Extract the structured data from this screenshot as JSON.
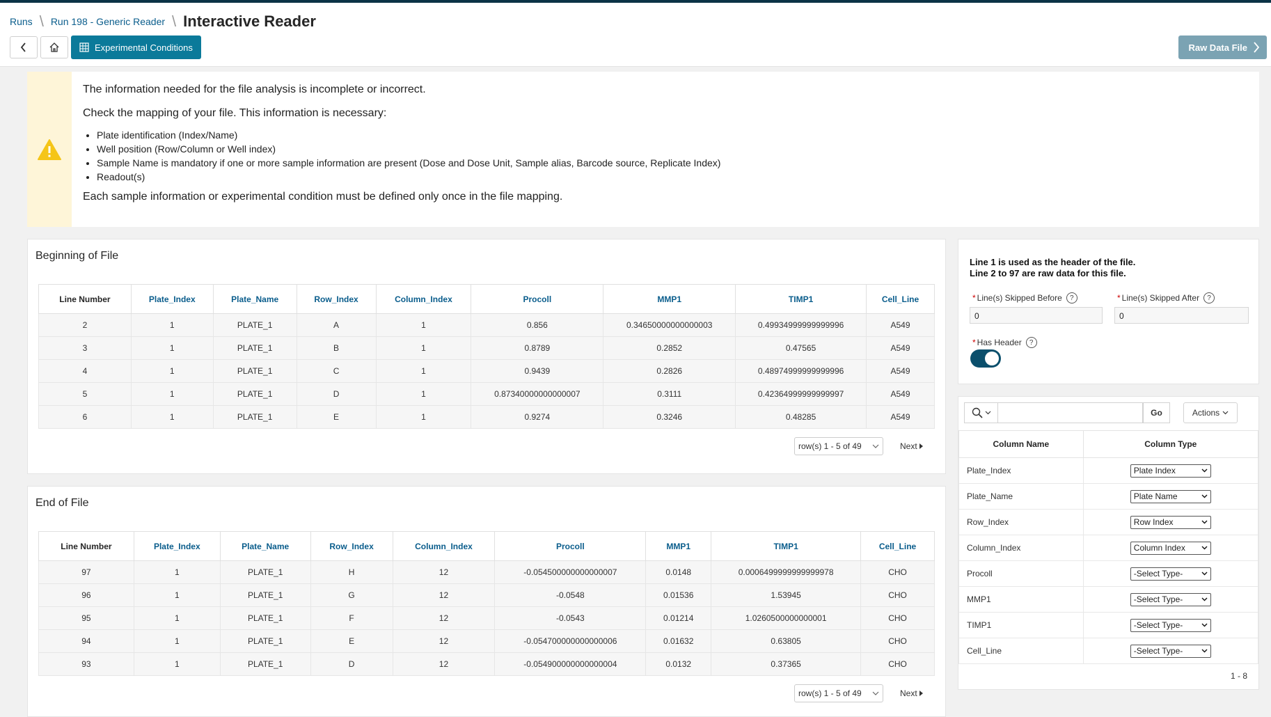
{
  "breadcrumb": {
    "runs": "Runs",
    "run": "Run 198 - Generic Reader",
    "title": "Interactive Reader"
  },
  "toolbar": {
    "experimental_conditions": "Experimental Conditions",
    "raw_data_file": "Raw Data File"
  },
  "alert": {
    "line1": "The information needed for the file analysis is incomplete or incorrect.",
    "line2": "Check the mapping of your file. This information is necessary:",
    "items": [
      "Plate identification (Index/Name)",
      "Well position (Row/Column or Well index)",
      "Sample Name is mandatory if one or more sample information are present (Dose and Dose Unit, Sample alias, Barcode source, Replicate Index)",
      "Readout(s)"
    ],
    "line3": "Each sample information or experimental condition must be defined only once in the file mapping."
  },
  "beginning": {
    "title": "Beginning of File",
    "headers": [
      "Line Number",
      "Plate_Index",
      "Plate_Name",
      "Row_Index",
      "Column_Index",
      "Procoll",
      "MMP1",
      "TIMP1",
      "Cell_Line"
    ],
    "rows": [
      [
        "2",
        "1",
        "PLATE_1",
        "A",
        "1",
        "0.856",
        "0.34650000000000003",
        "0.49934999999999996",
        "A549"
      ],
      [
        "3",
        "1",
        "PLATE_1",
        "B",
        "1",
        "0.8789",
        "0.2852",
        "0.47565",
        "A549"
      ],
      [
        "4",
        "1",
        "PLATE_1",
        "C",
        "1",
        "0.9439",
        "0.2826",
        "0.48974999999999996",
        "A549"
      ],
      [
        "5",
        "1",
        "PLATE_1",
        "D",
        "1",
        "0.87340000000000007",
        "0.3111",
        "0.42364999999999997",
        "A549"
      ],
      [
        "6",
        "1",
        "PLATE_1",
        "E",
        "1",
        "0.9274",
        "0.3246",
        "0.48285",
        "A549"
      ]
    ],
    "pager": "row(s) 1 - 5 of 49",
    "next": "Next"
  },
  "end": {
    "title": "End of File",
    "headers": [
      "Line Number",
      "Plate_Index",
      "Plate_Name",
      "Row_Index",
      "Column_Index",
      "Procoll",
      "MMP1",
      "TIMP1",
      "Cell_Line"
    ],
    "rows": [
      [
        "97",
        "1",
        "PLATE_1",
        "H",
        "12",
        "-0.054500000000000007",
        "0.0148",
        "0.0006499999999999978",
        "CHO"
      ],
      [
        "96",
        "1",
        "PLATE_1",
        "G",
        "12",
        "-0.0548",
        "0.01536",
        "1.53945",
        "CHO"
      ],
      [
        "95",
        "1",
        "PLATE_1",
        "F",
        "12",
        "-0.0543",
        "0.01214",
        "1.0260500000000001",
        "CHO"
      ],
      [
        "94",
        "1",
        "PLATE_1",
        "E",
        "12",
        "-0.054700000000000006",
        "0.01632",
        "0.63805",
        "CHO"
      ],
      [
        "93",
        "1",
        "PLATE_1",
        "D",
        "12",
        "-0.054900000000000004",
        "0.0132",
        "0.37365",
        "CHO"
      ]
    ],
    "pager": "row(s) 1 - 5 of 49",
    "next": "Next"
  },
  "settings": {
    "info1": "Line 1 is used as the header of the file.",
    "info2": "Line 2 to 97 are raw data for this file.",
    "skipped_before_label": "Line(s) Skipped Before",
    "skipped_before_value": "0",
    "skipped_after_label": "Line(s) Skipped After",
    "skipped_after_value": "0",
    "has_header_label": "Has Header",
    "required_mark": "*",
    "help": "?"
  },
  "mapping": {
    "go": "Go",
    "actions": "Actions",
    "headers": [
      "Column Name",
      "Column Type"
    ],
    "rows": [
      [
        "Plate_Index",
        "Plate Index"
      ],
      [
        "Plate_Name",
        "Plate Name"
      ],
      [
        "Row_Index",
        "Row Index"
      ],
      [
        "Column_Index",
        "Column Index"
      ],
      [
        "Procoll",
        "-Select Type-"
      ],
      [
        "MMP1",
        "-Select Type-"
      ],
      [
        "TIMP1",
        "-Select Type-"
      ],
      [
        "Cell_Line",
        "-Select Type-"
      ]
    ],
    "count": "1 - 8"
  }
}
